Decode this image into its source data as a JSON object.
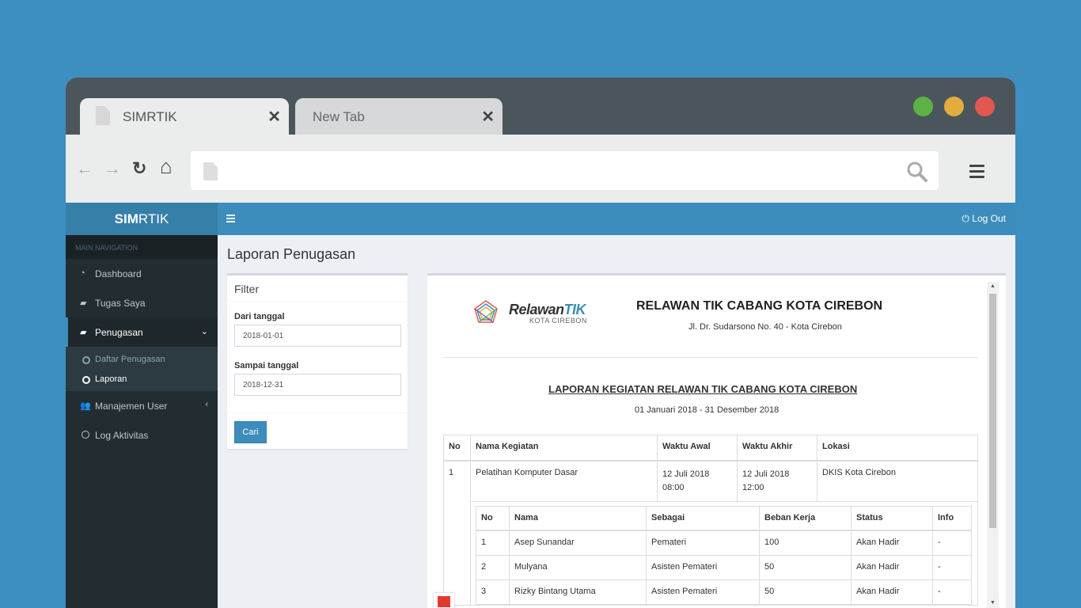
{
  "browser": {
    "tabs": [
      {
        "label": "SIMRTIK",
        "close": "✕"
      },
      {
        "label": "New Tab",
        "close": "✕"
      }
    ],
    "nav": {
      "back": "←",
      "forward": "→",
      "reload": "↻",
      "home": "⌂"
    },
    "url": "",
    "window_dots": [
      "#5cb244",
      "#e3ac3e",
      "#e0584e"
    ]
  },
  "app": {
    "logo_bold": "SIM",
    "logo_rest": "RTIK",
    "logout_label": "Log Out",
    "sidebar": {
      "header": "MAIN NAVIGATION",
      "items": [
        {
          "label": "Dashboard",
          "icon": "dashboard-icon"
        },
        {
          "label": "Tugas Saya",
          "icon": "book-icon"
        },
        {
          "label": "Penugasan",
          "icon": "book-icon"
        },
        {
          "label": "Manajemen User",
          "icon": "users-icon"
        },
        {
          "label": "Log Aktivitas",
          "icon": "circle-icon"
        }
      ],
      "submenu": [
        {
          "label": "Daftar Penugasan"
        },
        {
          "label": "Laporan"
        }
      ]
    },
    "page_title": "Laporan Penugasan",
    "filter": {
      "title": "Filter",
      "from_label": "Dari tanggal",
      "from_value": "2018-01-01",
      "to_label": "Sampai tanggal",
      "to_value": "2018-12-31",
      "button": "Cari"
    },
    "report": {
      "logo_word": "Relawan",
      "logo_accent": "TIK",
      "logo_sub": "KOTA CIREBON",
      "org_name": "RELAWAN TIK CABANG KOTA CIREBON",
      "address": "Jl. Dr. Sudarsono No. 40 - Kota Cirebon",
      "title": "LAPORAN KEGIATAN RELAWAN TIK CABANG KOTA CIREBON",
      "period": "01 Januari 2018 - 31 Desember 2018",
      "columns": [
        "No",
        "Nama Kegiatan",
        "Waktu Awal",
        "Waktu Akhir",
        "Lokasi"
      ],
      "activity": {
        "no": "1",
        "name": "Pelatihan Komputer Dasar",
        "start_date": "12 Juli 2018",
        "start_time": "08:00",
        "end_date": "12 Juli 2018",
        "end_time": "12:00",
        "location": "DKIS Kota Cirebon"
      },
      "member_columns": [
        "No",
        "Nama",
        "Sebagai",
        "Beban Kerja",
        "Status",
        "Info"
      ],
      "members": [
        {
          "no": "1",
          "name": "Asep Sunandar",
          "role": "Pemateri",
          "load": "100",
          "status": "Akan Hadir",
          "info": "-"
        },
        {
          "no": "2",
          "name": "Mulyana",
          "role": "Asisten Pemateri",
          "load": "50",
          "status": "Akan Hadir",
          "info": "-"
        },
        {
          "no": "3",
          "name": "Rizky Bintang Utama",
          "role": "Asisten Pemateri",
          "load": "50",
          "status": "Akan Hadir",
          "info": "-"
        }
      ]
    }
  }
}
